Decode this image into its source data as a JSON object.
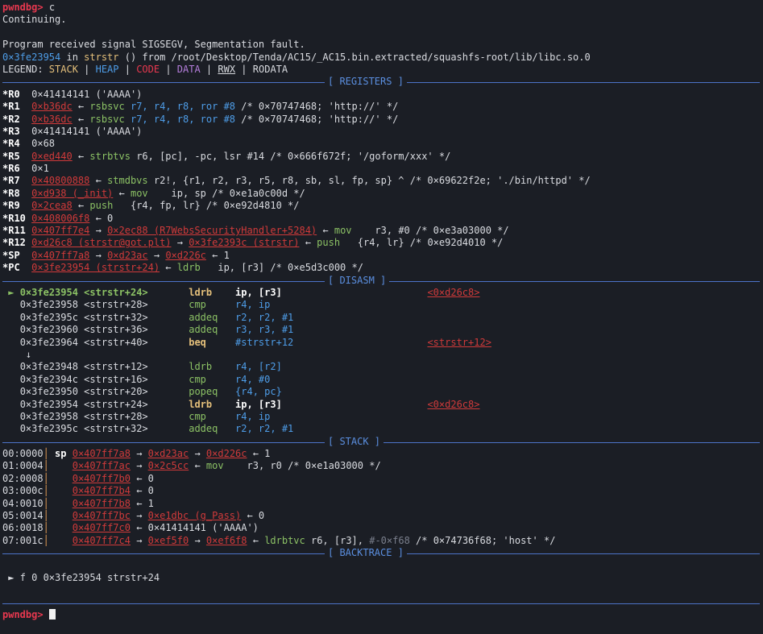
{
  "prompt": "pwndbg>",
  "command": "c",
  "continuing": "Continuing.",
  "signal_line": "Program received signal SIGSEGV, Segmentation fault.",
  "fault_addr": "0×3fe23954",
  "fault_in": " in ",
  "fault_func": "strstr",
  "fault_from": " () from ",
  "fault_lib": "/root/Desktop/Tenda/AC15/_AC15.bin.extracted/squashfs-root/lib/libc.so.0",
  "legend": {
    "label": "LEGEND: ",
    "stack": "STACK",
    "heap": "HEAP",
    "code": "CODE",
    "data": "DATA",
    "rwx": "RWX",
    "rodata": "RODATA",
    "sep": " | "
  },
  "sections": {
    "registers": "[ REGISTERS ]",
    "disasm": "[ DISASM ]",
    "stack": "[ STACK ]",
    "backtrace": "[ BACKTRACE ]"
  },
  "registers": [
    {
      "name": "*R0",
      "segs": [
        {
          "t": "0×41414141 ('AAAA')",
          "c": ""
        }
      ]
    },
    {
      "name": "*R1",
      "segs": [
        {
          "t": "0×b36dc",
          "c": "redu"
        },
        {
          "t": " ← ",
          "c": ""
        },
        {
          "t": "rsbsvc ",
          "c": "green"
        },
        {
          "t": "r7, r4, r8, ror #8",
          "c": "blue"
        },
        {
          "t": " /* 0×70747468; 'http://' */",
          "c": ""
        }
      ]
    },
    {
      "name": "*R2",
      "segs": [
        {
          "t": "0×b36dc",
          "c": "redu"
        },
        {
          "t": " ← ",
          "c": ""
        },
        {
          "t": "rsbsvc ",
          "c": "green"
        },
        {
          "t": "r7, r4, r8, ror #8",
          "c": "blue"
        },
        {
          "t": " /* 0×70747468; 'http://' */",
          "c": ""
        }
      ]
    },
    {
      "name": "*R3",
      "segs": [
        {
          "t": "0×41414141 ('AAAA')",
          "c": ""
        }
      ]
    },
    {
      "name": "*R4",
      "segs": [
        {
          "t": "0×68",
          "c": ""
        }
      ]
    },
    {
      "name": "*R5",
      "segs": [
        {
          "t": "0×ed440",
          "c": "redu"
        },
        {
          "t": " ← ",
          "c": ""
        },
        {
          "t": "strbtvs ",
          "c": "green"
        },
        {
          "t": "r6, [pc], -pc, lsr #14 /* 0×666f672f; '/goform/xxx' */",
          "c": ""
        }
      ]
    },
    {
      "name": "*R6",
      "segs": [
        {
          "t": "0×1",
          "c": ""
        }
      ]
    },
    {
      "name": "*R7",
      "segs": [
        {
          "t": "0×40800888",
          "c": "redu"
        },
        {
          "t": " ← ",
          "c": ""
        },
        {
          "t": "stmdbvs ",
          "c": "green"
        },
        {
          "t": "r2!, {r1, r2, r3, r5, r8, sb, sl, fp, sp} ^ /* 0×69622f2e; './bin/httpd' */",
          "c": ""
        }
      ]
    },
    {
      "name": "*R8",
      "segs": [
        {
          "t": "0×d938 (_init)",
          "c": "redu"
        },
        {
          "t": " ← ",
          "c": ""
        },
        {
          "t": "mov    ",
          "c": "green"
        },
        {
          "t": "ip, sp /* 0×e1a0c00d */",
          "c": ""
        }
      ]
    },
    {
      "name": "*R9",
      "segs": [
        {
          "t": "0×2cea8",
          "c": "redu"
        },
        {
          "t": " ← ",
          "c": ""
        },
        {
          "t": "push   ",
          "c": "green"
        },
        {
          "t": "{r4, fp, lr} /* 0×e92d4810 */",
          "c": ""
        }
      ]
    },
    {
      "name": "*R10",
      "segs": [
        {
          "t": "0×408006f8",
          "c": "redu"
        },
        {
          "t": " ← 0",
          "c": ""
        }
      ]
    },
    {
      "name": "*R11",
      "segs": [
        {
          "t": "0×407ff7e4",
          "c": "redu"
        },
        {
          "t": " → ",
          "c": ""
        },
        {
          "t": "0×2ec88 (R7WebsSecurityHandler+5284)",
          "c": "redu"
        },
        {
          "t": " ← ",
          "c": ""
        },
        {
          "t": "mov    ",
          "c": "green"
        },
        {
          "t": "r3, #0 /* 0×e3a03000 */",
          "c": ""
        }
      ]
    },
    {
      "name": "*R12",
      "segs": [
        {
          "t": "0×d26c8 (strstr@got.plt)",
          "c": "redu"
        },
        {
          "t": " → ",
          "c": ""
        },
        {
          "t": "0×3fe2393c (strstr)",
          "c": "redu"
        },
        {
          "t": " ← ",
          "c": ""
        },
        {
          "t": "push   ",
          "c": "green"
        },
        {
          "t": "{r4, lr} /* 0×e92d4010 */",
          "c": ""
        }
      ]
    },
    {
      "name": "*SP",
      "segs": [
        {
          "t": "0×407ff7a8",
          "c": "redu"
        },
        {
          "t": " → ",
          "c": ""
        },
        {
          "t": "0×d23ac",
          "c": "redu"
        },
        {
          "t": " → ",
          "c": ""
        },
        {
          "t": "0×d226c",
          "c": "redu"
        },
        {
          "t": " ← 1",
          "c": ""
        }
      ]
    },
    {
      "name": "*PC",
      "segs": [
        {
          "t": "0×3fe23954 (strstr+24)",
          "c": "redu"
        },
        {
          "t": " ← ",
          "c": ""
        },
        {
          "t": "ldrb   ",
          "c": "green"
        },
        {
          "t": "ip, [r3] /* 0×e5d3c000 */",
          "c": ""
        }
      ]
    }
  ],
  "disasm": [
    {
      "marker": " ► ",
      "addr": "0×3fe23954",
      "sym": "<strstr+24>",
      "op": "ldrb",
      "args": "ip, [r3]",
      "ref": "<0×d26c8>",
      "cur": true
    },
    {
      "marker": "   ",
      "addr": "0×3fe23958",
      "sym": "<strstr+28>",
      "op": "cmp",
      "args": "r4, ip",
      "ref": "",
      "cur": false
    },
    {
      "marker": "   ",
      "addr": "0×3fe2395c",
      "sym": "<strstr+32>",
      "op": "addeq",
      "args": "r2, r2, #1",
      "ref": "",
      "cur": false
    },
    {
      "marker": "   ",
      "addr": "0×3fe23960",
      "sym": "<strstr+36>",
      "op": "addeq",
      "args": "r3, r3, #1",
      "ref": "",
      "cur": false
    },
    {
      "marker": "   ",
      "addr": "0×3fe23964",
      "sym": "<strstr+40>",
      "op": "beq",
      "args": "#strstr+12",
      "ref": "<strstr+12>",
      "cur": false,
      "branch": true
    },
    {
      "marker": "    ↓",
      "addr": "",
      "sym": "",
      "op": "",
      "args": "",
      "ref": "",
      "cur": false,
      "arrow": true
    },
    {
      "marker": "   ",
      "addr": "0×3fe23948",
      "sym": "<strstr+12>",
      "op": "ldrb",
      "args": "r4, [r2]",
      "ref": "",
      "cur": false
    },
    {
      "marker": "   ",
      "addr": "0×3fe2394c",
      "sym": "<strstr+16>",
      "op": "cmp",
      "args": "r4, #0",
      "ref": "",
      "cur": false
    },
    {
      "marker": "   ",
      "addr": "0×3fe23950",
      "sym": "<strstr+20>",
      "op": "popeq",
      "args": "{r4, pc}",
      "ref": "",
      "cur": false
    },
    {
      "marker": "   ",
      "addr": "0×3fe23954",
      "sym": "<strstr+24>",
      "op": "ldrb",
      "args": "ip, [r3]",
      "ref": "<0×d26c8>",
      "cur": false,
      "hl": true
    },
    {
      "marker": "   ",
      "addr": "0×3fe23958",
      "sym": "<strstr+28>",
      "op": "cmp",
      "args": "r4, ip",
      "ref": "",
      "cur": false
    },
    {
      "marker": "   ",
      "addr": "0×3fe2395c",
      "sym": "<strstr+32>",
      "op": "addeq",
      "args": "r2, r2, #1",
      "ref": "",
      "cur": false
    }
  ],
  "stack": [
    {
      "off": "00:0000",
      "reg": "sp",
      "segs": [
        {
          "t": "0×407ff7a8",
          "c": "redu"
        },
        {
          "t": " → ",
          "c": ""
        },
        {
          "t": "0×d23ac",
          "c": "redu"
        },
        {
          "t": " → ",
          "c": ""
        },
        {
          "t": "0×d226c",
          "c": "redu"
        },
        {
          "t": " ← 1",
          "c": ""
        }
      ]
    },
    {
      "off": "01:0004",
      "reg": "",
      "segs": [
        {
          "t": "0×407ff7ac",
          "c": "redu"
        },
        {
          "t": " → ",
          "c": ""
        },
        {
          "t": "0×2c5cc",
          "c": "redu"
        },
        {
          "t": " ← ",
          "c": ""
        },
        {
          "t": "mov    ",
          "c": "green"
        },
        {
          "t": "r3, r0 /* 0×e1a03000 */",
          "c": ""
        }
      ]
    },
    {
      "off": "02:0008",
      "reg": "",
      "segs": [
        {
          "t": "0×407ff7b0",
          "c": "redu"
        },
        {
          "t": " ← 0",
          "c": ""
        }
      ]
    },
    {
      "off": "03:000c",
      "reg": "",
      "segs": [
        {
          "t": "0×407ff7b4",
          "c": "redu"
        },
        {
          "t": " ← 0",
          "c": ""
        }
      ]
    },
    {
      "off": "04:0010",
      "reg": "",
      "segs": [
        {
          "t": "0×407ff7b8",
          "c": "redu"
        },
        {
          "t": " ← 1",
          "c": ""
        }
      ]
    },
    {
      "off": "05:0014",
      "reg": "",
      "segs": [
        {
          "t": "0×407ff7bc",
          "c": "redu"
        },
        {
          "t": " → ",
          "c": ""
        },
        {
          "t": "0×e1dbc (g_Pass)",
          "c": "redu"
        },
        {
          "t": " ← 0",
          "c": ""
        }
      ]
    },
    {
      "off": "06:0018",
      "reg": "",
      "segs": [
        {
          "t": "0×407ff7c0",
          "c": "redu"
        },
        {
          "t": " ← 0×41414141 ('AAAA')",
          "c": ""
        }
      ]
    },
    {
      "off": "07:001c",
      "reg": "",
      "segs": [
        {
          "t": "0×407ff7c4",
          "c": "redu"
        },
        {
          "t": " → ",
          "c": ""
        },
        {
          "t": "0×ef5f0",
          "c": "redu"
        },
        {
          "t": " → ",
          "c": ""
        },
        {
          "t": "0×ef6f8",
          "c": "redu"
        },
        {
          "t": " ← ",
          "c": ""
        },
        {
          "t": "ldrbtvc ",
          "c": "green"
        },
        {
          "t": "r6, [r3], ",
          "c": ""
        },
        {
          "t": "#-0×f68",
          "c": "dim"
        },
        {
          "t": " /* 0×74736f68; 'host' */",
          "c": ""
        }
      ]
    }
  ],
  "backtrace": [
    {
      "marker": " ► ",
      "text": "f 0 0×3fe23954 strstr+24"
    }
  ],
  "colors": {
    "background": "#1b1e25",
    "prompt": "#e8384f",
    "separator": "#4d73c8",
    "address": "#d03a3a",
    "opcode": "#8cc265"
  }
}
